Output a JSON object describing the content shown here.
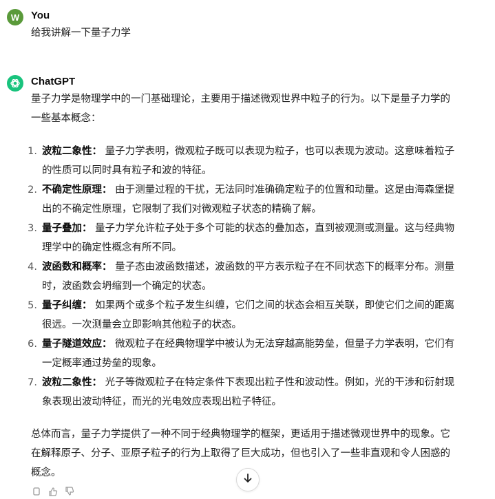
{
  "user": {
    "avatar_letter": "W",
    "name": "You",
    "message": "给我讲解一下量子力学"
  },
  "assistant": {
    "name": "ChatGPT",
    "intro": "量子力学是物理学中的一门基础理论，主要用于描述微观世界中粒子的行为。以下是量子力学的一些基本概念：",
    "items": [
      {
        "num": "1.",
        "term": "波粒二象性：",
        "text": "量子力学表明，微观粒子既可以表现为粒子，也可以表现为波动。这意味着粒子的性质可以同时具有粒子和波的特征。"
      },
      {
        "num": "2.",
        "term": "不确定性原理：",
        "text": "由于测量过程的干扰，无法同时准确确定粒子的位置和动量。这是由海森堡提出的不确定性原理，它限制了我们对微观粒子状态的精确了解。"
      },
      {
        "num": "3.",
        "term": "量子叠加：",
        "text": "量子力学允许粒子处于多个可能的状态的叠加态，直到被观测或测量。这与经典物理学中的确定性概念有所不同。"
      },
      {
        "num": "4.",
        "term": "波函数和概率：",
        "text": "量子态由波函数描述，波函数的平方表示粒子在不同状态下的概率分布。测量时，波函数会坍缩到一个确定的状态。"
      },
      {
        "num": "5.",
        "term": "量子纠缠：",
        "text": "如果两个或多个粒子发生纠缠，它们之间的状态会相互关联，即使它们之间的距离很远。一次测量会立即影响其他粒子的状态。"
      },
      {
        "num": "6.",
        "term": "量子隧道效应：",
        "text": "微观粒子在经典物理学中被认为无法穿越高能势垒，但量子力学表明，它们有一定概率通过势垒的现象。"
      },
      {
        "num": "7.",
        "term": "波粒二象性：",
        "text": "光子等微观粒子在特定条件下表现出粒子性和波动性。例如，光的干涉和衍射现象表现出波动特征，而光的光电效应表现出粒子特征。"
      }
    ],
    "conclusion": "总体而言，量子力学提供了一种不同于经典物理学的框架，更适用于描述微观世界中的现象。它在解释原子、分子、亚原子粒子的行为上取得了巨大成功，但也引入了一些非直观和令人困惑的概念。"
  },
  "icons": {
    "scroll": "arrow-down-icon",
    "copy": "copy-icon",
    "like": "thumbs-up-icon",
    "dislike": "thumbs-down-icon",
    "assistant_logo": "openai-logo-icon"
  },
  "colors": {
    "user_avatar": "#5a9a3a",
    "assistant_avatar": "#19c37d"
  }
}
